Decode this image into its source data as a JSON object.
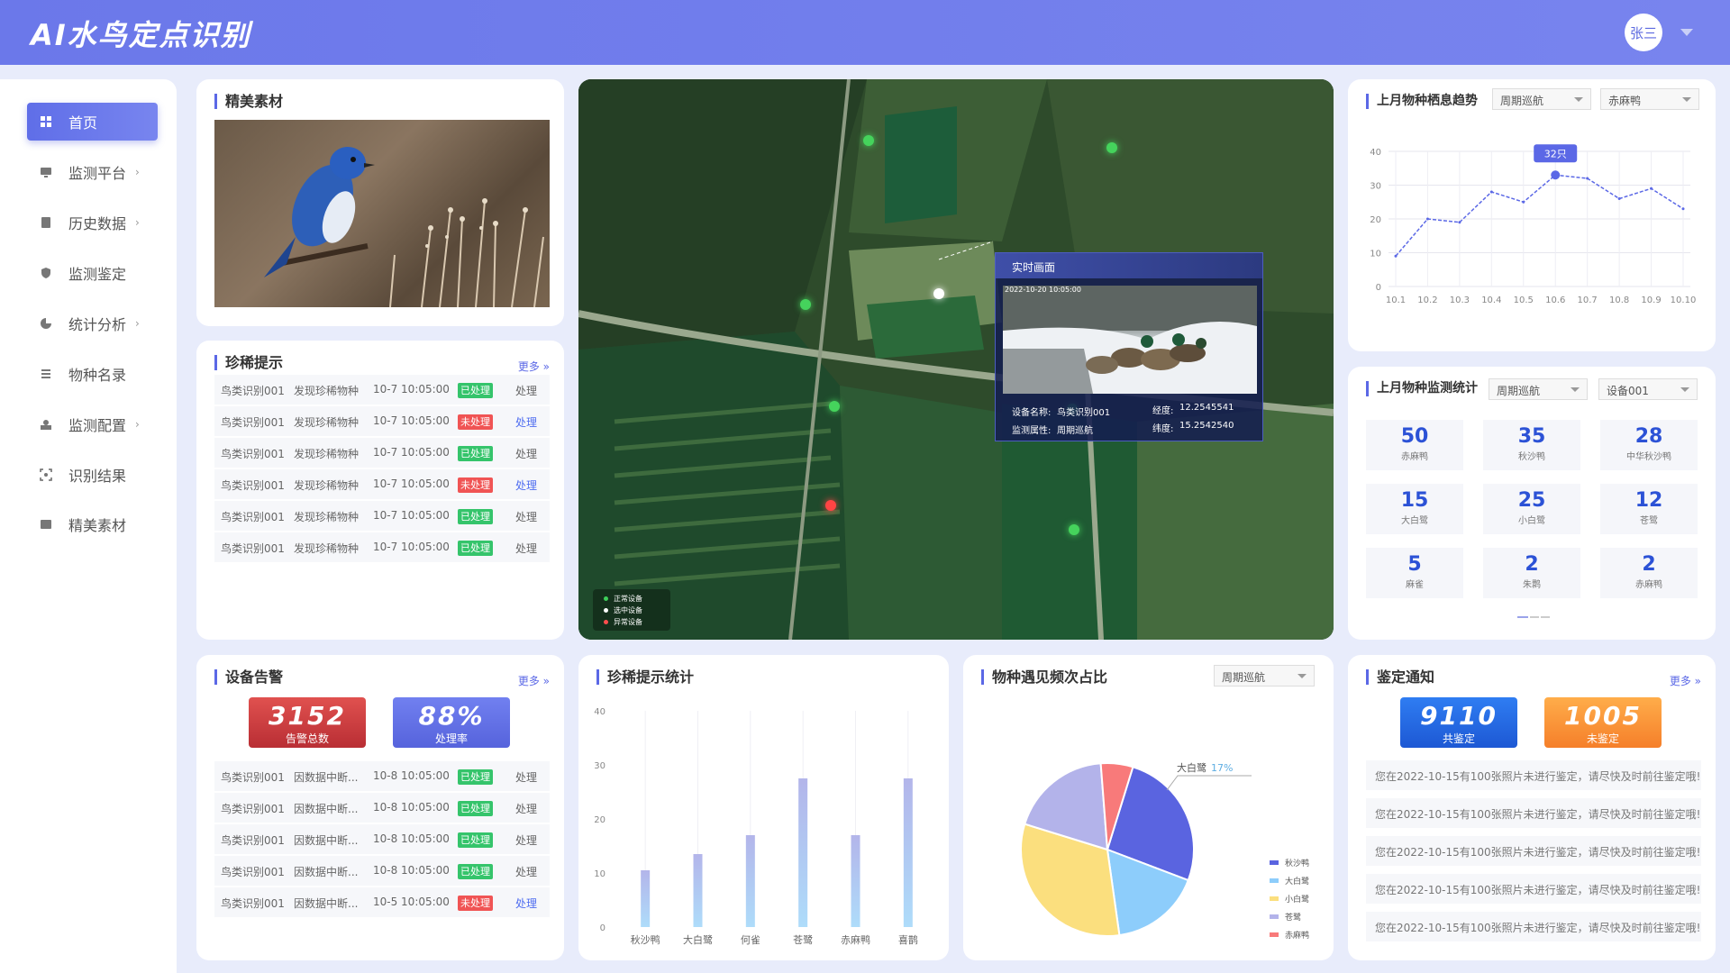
{
  "app": {
    "title": "AI水鸟定点识别",
    "user": "张三"
  },
  "sidebar": {
    "items": [
      {
        "label": "首页",
        "active": true,
        "icon": "grid-icon",
        "chevron": ""
      },
      {
        "label": "监测平台",
        "icon": "monitor-icon",
        "chevron": "›"
      },
      {
        "label": "历史数据",
        "icon": "document-icon",
        "chevron": "›"
      },
      {
        "label": "监测鉴定",
        "icon": "shield-icon",
        "chevron": ""
      },
      {
        "label": "统计分析",
        "icon": "pie-icon",
        "chevron": "›"
      },
      {
        "label": "物种名录",
        "icon": "list-icon",
        "chevron": ""
      },
      {
        "label": "监测配置",
        "icon": "config-icon",
        "chevron": "›"
      },
      {
        "label": "识别结果",
        "icon": "scan-icon",
        "chevron": ""
      },
      {
        "label": "精美素材",
        "icon": "image-icon",
        "chevron": ""
      }
    ]
  },
  "gallery": {
    "title": "精美素材"
  },
  "rare": {
    "title": "珍稀提示",
    "more": "更多 »",
    "rows": [
      {
        "device": "鸟类识别001",
        "event": "发现珍稀物种",
        "time": "10-7 10:05:00",
        "status": "已处理",
        "done": true,
        "action": "处理"
      },
      {
        "device": "鸟类识别001",
        "event": "发现珍稀物种",
        "time": "10-7 10:05:00",
        "status": "未处理",
        "done": false,
        "action": "处理"
      },
      {
        "device": "鸟类识别001",
        "event": "发现珍稀物种",
        "time": "10-7 10:05:00",
        "status": "已处理",
        "done": true,
        "action": "处理"
      },
      {
        "device": "鸟类识别001",
        "event": "发现珍稀物种",
        "time": "10-7 10:05:00",
        "status": "未处理",
        "done": false,
        "action": "处理"
      },
      {
        "device": "鸟类识别001",
        "event": "发现珍稀物种",
        "time": "10-7 10:05:00",
        "status": "已处理",
        "done": true,
        "action": "处理"
      },
      {
        "device": "鸟类识别001",
        "event": "发现珍稀物种",
        "time": "10-7 10:05:00",
        "status": "已处理",
        "done": true,
        "action": "处理"
      }
    ]
  },
  "alarm": {
    "title": "设备告警",
    "more": "更多 »",
    "total": "3152",
    "total_label": "告警总数",
    "rate": "88%",
    "rate_label": "处理率",
    "rows": [
      {
        "device": "鸟类识别001",
        "event": "因数据中断...",
        "time": "10-8 10:05:00",
        "status": "已处理",
        "done": true,
        "action": "处理"
      },
      {
        "device": "鸟类识别001",
        "event": "因数据中断...",
        "time": "10-8 10:05:00",
        "status": "已处理",
        "done": true,
        "action": "处理"
      },
      {
        "device": "鸟类识别001",
        "event": "因数据中断...",
        "time": "10-8 10:05:00",
        "status": "已处理",
        "done": true,
        "action": "处理"
      },
      {
        "device": "鸟类识别001",
        "event": "因数据中断...",
        "time": "10-8 10:05:00",
        "status": "已处理",
        "done": true,
        "action": "处理"
      },
      {
        "device": "鸟类识别001",
        "event": "因数据中断...",
        "time": "10-5 10:05:00",
        "status": "未处理",
        "done": false,
        "action": "处理"
      }
    ]
  },
  "map": {
    "popup_title": "实时画面",
    "timestamp": "2022-10-20 10:05:00",
    "device_label": "设备名称:",
    "device_value": "鸟类识别001",
    "lng_label": "经度:",
    "lng_value": "12.2545541",
    "attr_label": "监测属性:",
    "attr_value": "周期巡航",
    "lat_label": "纬度:",
    "lat_value": "15.2542540",
    "legend": [
      {
        "label": "正常设备",
        "color": "#3ecf5a"
      },
      {
        "label": "选中设备",
        "color": "#ffffff"
      },
      {
        "label": "异常设备",
        "color": "#ff4d4d"
      }
    ],
    "colors": {
      "normal": "#45d35c",
      "selected": "#ffffff",
      "abnormal": "#ff4444"
    }
  },
  "trend": {
    "title": "上月物种栖息趋势",
    "select1": "周期巡航",
    "select2": "赤麻鸭",
    "tooltip": "32只"
  },
  "monitor": {
    "title": "上月物种监测统计",
    "select1": "周期巡航",
    "select2": "设备001",
    "stats": [
      {
        "num": "50",
        "label": "赤麻鸭"
      },
      {
        "num": "35",
        "label": "秋沙鸭"
      },
      {
        "num": "28",
        "label": "中华秋沙鸭"
      },
      {
        "num": "15",
        "label": "大白鹭"
      },
      {
        "num": "25",
        "label": "小白鹭"
      },
      {
        "num": "12",
        "label": "苍鹭"
      },
      {
        "num": "5",
        "label": "麻雀"
      },
      {
        "num": "2",
        "label": "朱鹮"
      },
      {
        "num": "2",
        "label": "赤麻鸭"
      }
    ]
  },
  "rare_stats": {
    "title": "珍稀提示统计"
  },
  "freq": {
    "title": "物种遇见频次占比",
    "select": "周期巡航",
    "callout_name": "大白鹭",
    "callout_value": "17%"
  },
  "appraisal": {
    "title": "鉴定通知",
    "more": "更多 »",
    "total": "9110",
    "total_label": "共鉴定",
    "pending": "1005",
    "pending_label": "未鉴定",
    "notices": [
      "您在2022-10-15有100张照片未进行鉴定，请尽快及时前往鉴定哦!",
      "您在2022-10-15有100张照片未进行鉴定，请尽快及时前往鉴定哦!",
      "您在2022-10-15有100张照片未进行鉴定，请尽快及时前往鉴定哦!",
      "您在2022-10-15有100张照片未进行鉴定，请尽快及时前往鉴定哦!",
      "您在2022-10-15有100张照片未进行鉴定，请尽快及时前往鉴定哦!"
    ]
  },
  "chart_data": [
    {
      "type": "line",
      "x": [
        "10.1",
        "10.2",
        "10.3",
        "10.4",
        "10.5",
        "10.6",
        "10.7",
        "10.8",
        "10.9",
        "10.10"
      ],
      "values": [
        9,
        20,
        19,
        28,
        25,
        33,
        32,
        26,
        29,
        23
      ],
      "ylim": [
        0,
        40
      ],
      "yticks": [
        "40",
        "30",
        "20",
        "10",
        "0"
      ],
      "color": "#5b68e6"
    },
    {
      "type": "bar",
      "categories": [
        "秋沙鸭",
        "大白鹭",
        "何雀",
        "苍鹭",
        "赤麻鸭",
        "喜鹊"
      ],
      "values": [
        10.5,
        13.5,
        17,
        27.5,
        17,
        27.5
      ],
      "ylim": [
        0,
        40
      ],
      "yticks": [
        "40",
        "30",
        "20",
        "10",
        "0"
      ],
      "color": "#b8bdec"
    },
    {
      "type": "pie",
      "slices": [
        {
          "name": "秋沙鸭",
          "value": 26,
          "color": "#5a64e0"
        },
        {
          "name": "大白鹭",
          "value": 17,
          "color": "#8dcdfb"
        },
        {
          "name": "小白鹭",
          "value": 32,
          "color": "#fbdf7e"
        },
        {
          "name": "苍鹭",
          "value": 19,
          "color": "#b3b3ea"
        },
        {
          "name": "赤麻鸭",
          "value": 6,
          "color": "#f87a7a"
        }
      ]
    }
  ]
}
